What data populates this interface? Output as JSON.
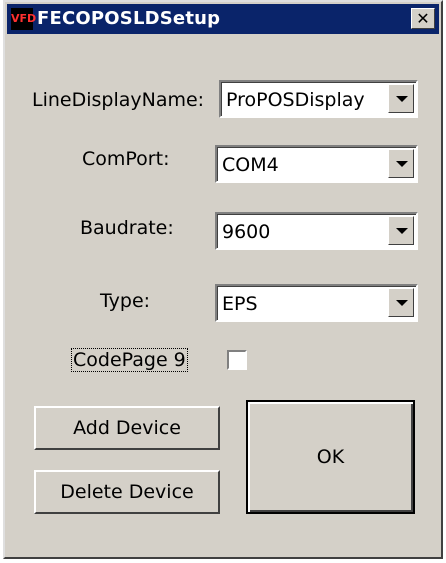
{
  "window": {
    "title": "FECOPOSLDSetup",
    "icon_text": "VFD",
    "close_glyph": "✕"
  },
  "form": {
    "line_display_name": {
      "label": "LineDisplayName:",
      "value": "ProPOSDisplay"
    },
    "com_port": {
      "label": "ComPort:",
      "value": "COM4"
    },
    "baudrate": {
      "label": "Baudrate:",
      "value": "9600"
    },
    "type": {
      "label": "Type:",
      "value": "EPS"
    },
    "codepage": {
      "label": "CodePage 9",
      "checked": false
    }
  },
  "buttons": {
    "add_device": "Add Device",
    "delete_device": "Delete Device",
    "ok": "OK"
  },
  "colors": {
    "titlebar": "#0a246a",
    "face": "#d4d0c8"
  },
  "icons": {
    "app": "vfd-display-icon",
    "close": "close-icon",
    "dropdown": "chevron-down-icon"
  }
}
